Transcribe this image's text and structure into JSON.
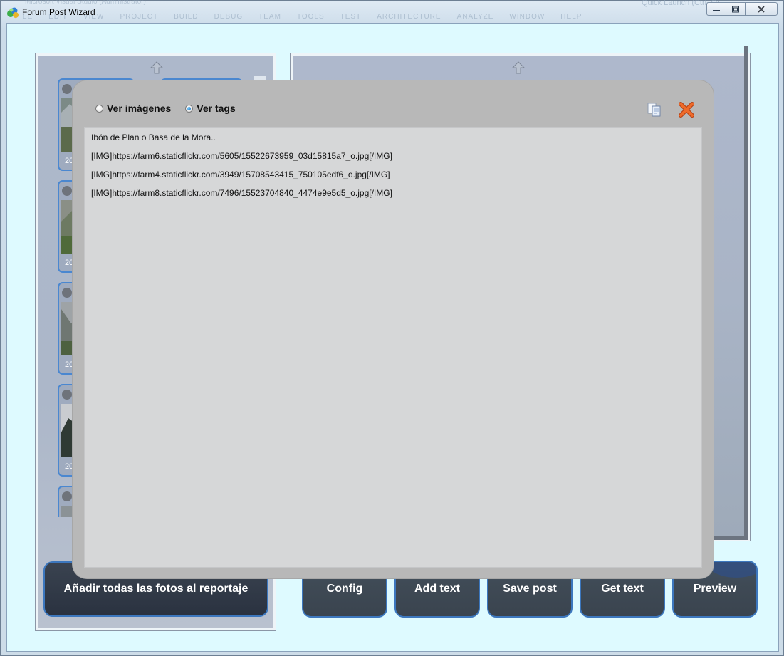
{
  "window": {
    "title": "Forum Post Wizard",
    "background_menu": [
      "FILE",
      "EDIT",
      "VIEW",
      "PROJECT",
      "BUILD",
      "DEBUG",
      "TEAM",
      "TOOLS",
      "TEST",
      "ARCHITECTURE",
      "ANALYZE",
      "WINDOW",
      "HELP"
    ],
    "background_title": "Microsoft Visual Studio (Administrator)",
    "background_quick_launch": "Quick Launch (Ctrl+Q)"
  },
  "left_panel": {
    "thumbnails": [
      {
        "date": "20"
      },
      {
        "date": "20"
      },
      {
        "date": "20"
      },
      {
        "date": "20"
      },
      {
        "date": ""
      }
    ],
    "add_all_label": "Añadir todas las fotos al reportaje"
  },
  "toolbar": {
    "config_label": "Config",
    "add_text_label": "Add text",
    "save_post_label": "Save post",
    "get_text_label": "Get text",
    "preview_label": "Preview"
  },
  "dialog": {
    "radio_images_label": "Ver imágenes",
    "radio_tags_label": "Ver tags",
    "selected": "tags",
    "lines": [
      "Ibón de Plan o Basa de la Mora..",
      "[IMG]https://farm6.staticflickr.com/5605/15522673959_03d15815a7_o.jpg[/IMG]",
      "[IMG]https://farm4.staticflickr.com/3949/15708543415_750105edf6_o.jpg[/IMG]",
      "[IMG]https://farm8.staticflickr.com/7496/15523704840_4474e9e5d5_o.jpg[/IMG]"
    ]
  },
  "colors": {
    "accent_border": "#4a87d0",
    "close_x": "#e25a1c",
    "client_bg": "#defaff"
  },
  "icons": {
    "app": "app-icon",
    "copy": "copy-icon",
    "close": "close-icon",
    "scroll_up": "arrow-up-icon"
  }
}
